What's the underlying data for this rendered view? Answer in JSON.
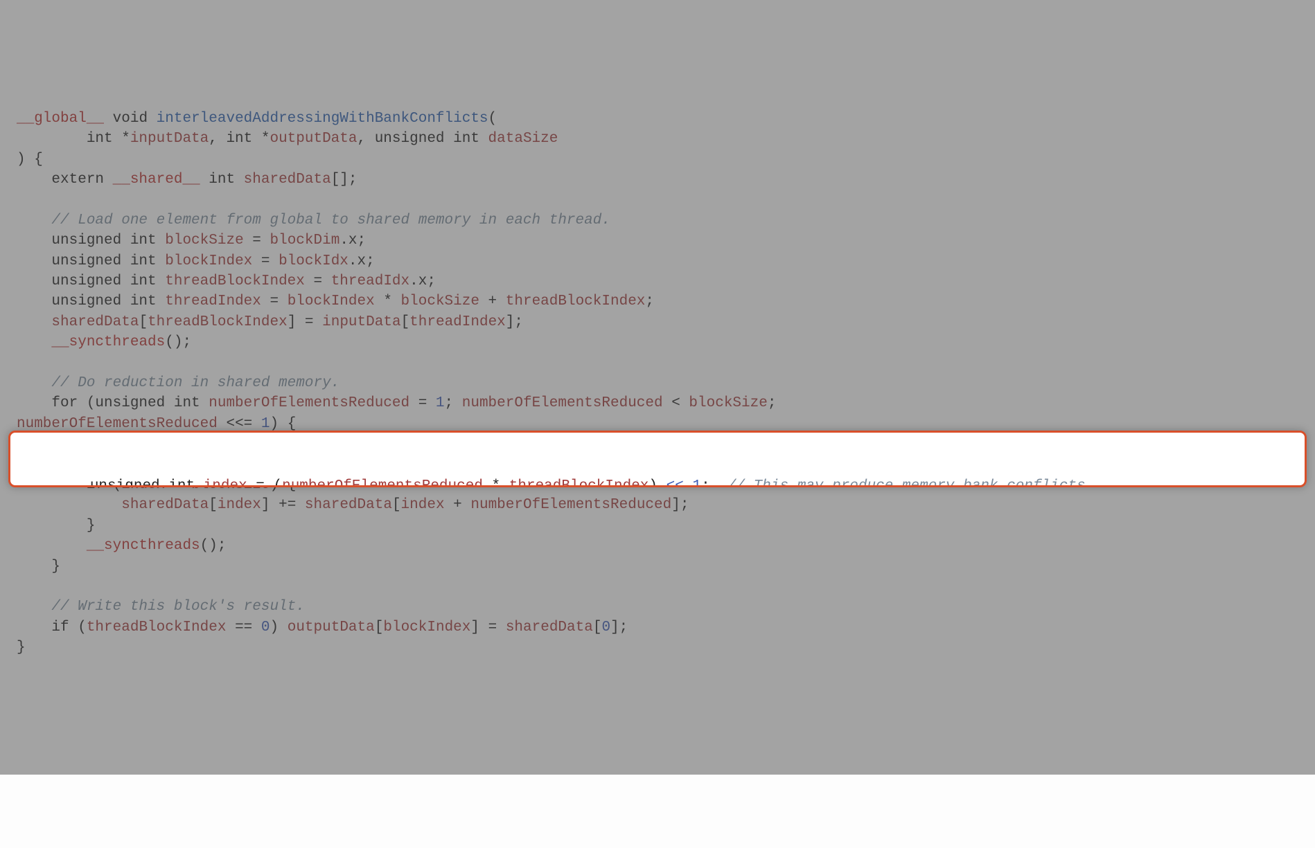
{
  "code": {
    "line1_kw_global": "__global__",
    "line1_void": " void ",
    "line1_fn": "interleavedAddressingWithBankConflicts",
    "line1_paren": "(",
    "line2_indent": "        int *",
    "line2_v1": "inputData",
    "line2_mid1": ", int *",
    "line2_v2": "outputData",
    "line2_mid2": ", unsigned int ",
    "line2_v3": "dataSize",
    "line3": ") {",
    "line4_pre": "    extern ",
    "line4_shared": "__shared__",
    "line4_mid": " int ",
    "line4_v": "sharedData",
    "line4_end": "[];",
    "line5": "",
    "line6_comment": "    // Load one element from global to shared memory in each thread.",
    "line7_pre": "    unsigned int ",
    "line7_v": "blockSize",
    "line7_mid": " = ",
    "line7_v2": "blockDim",
    "line7_end": ".x;",
    "line8_pre": "    unsigned int ",
    "line8_v": "blockIndex",
    "line8_mid": " = ",
    "line8_v2": "blockIdx",
    "line8_end": ".x;",
    "line9_pre": "    unsigned int ",
    "line9_v": "threadBlockIndex",
    "line9_mid": " = ",
    "line9_v2": "threadIdx",
    "line9_end": ".x;",
    "line10_pre": "    unsigned int ",
    "line10_v": "threadIndex",
    "line10_mid": " = ",
    "line10_v2": "blockIndex",
    "line10_mid2": " * ",
    "line10_v3": "blockSize",
    "line10_mid3": " + ",
    "line10_v4": "threadBlockIndex",
    "line10_end": ";",
    "line11_pre": "    ",
    "line11_v1": "sharedData",
    "line11_mid1": "[",
    "line11_v2": "threadBlockIndex",
    "line11_mid2": "] = ",
    "line11_v3": "inputData",
    "line11_mid3": "[",
    "line11_v4": "threadIndex",
    "line11_end": "];",
    "line12_pre": "    ",
    "line12_sync": "__syncthreads",
    "line12_end": "();",
    "line13": "",
    "line14_comment": "    // Do reduction in shared memory.",
    "line15_pre": "    for (unsigned int ",
    "line15_v": "numberOfElementsReduced",
    "line15_mid": " = ",
    "line15_num": "1",
    "line15_mid2": "; ",
    "line15_v2": "numberOfElementsReduced",
    "line15_mid3": " < ",
    "line15_v3": "blockSize",
    "line15_end": ";",
    "line16_v": "numberOfElementsReduced",
    "line16_mid": " <<= ",
    "line16_num": "1",
    "line16_end": ") {",
    "line19_pre": "        if (",
    "line19_v1": "index",
    "line19_mid": " < ",
    "line19_v2": "blockSize",
    "line19_end": ") {",
    "line20_pre": "            ",
    "line20_v1": "sharedData",
    "line20_mid1": "[",
    "line20_v2": "index",
    "line20_mid2": "] += ",
    "line20_v3": "sharedData",
    "line20_mid3": "[",
    "line20_v4": "index",
    "line20_mid4": " + ",
    "line20_v5": "numberOfElementsReduced",
    "line20_end": "];",
    "line21": "        }",
    "line22_pre": "        ",
    "line22_sync": "__syncthreads",
    "line22_end": "();",
    "line23": "    }",
    "line24": "",
    "line25_comment": "    // Write this block's result.",
    "line26_pre": "    if (",
    "line26_v1": "threadBlockIndex",
    "line26_mid": " == ",
    "line26_num": "0",
    "line26_mid2": ") ",
    "line26_v2": "outputData",
    "line26_mid3": "[",
    "line26_v3": "blockIndex",
    "line26_mid4": "] = ",
    "line26_v4": "sharedData",
    "line26_mid5": "[",
    "line26_num2": "0",
    "line26_end": "];",
    "line27": "}"
  },
  "highlight": {
    "pre": "        unsigned int ",
    "v1": "index",
    "mid1": " = (",
    "v2": "numberOfElementsReduced",
    "mid2": " * ",
    "v3": "threadBlockIndex",
    "mid3": ") ",
    "shift": "<<",
    "sp": " ",
    "num": "1",
    "end": ";  ",
    "comment": "// This may produce memory bank conflicts."
  }
}
